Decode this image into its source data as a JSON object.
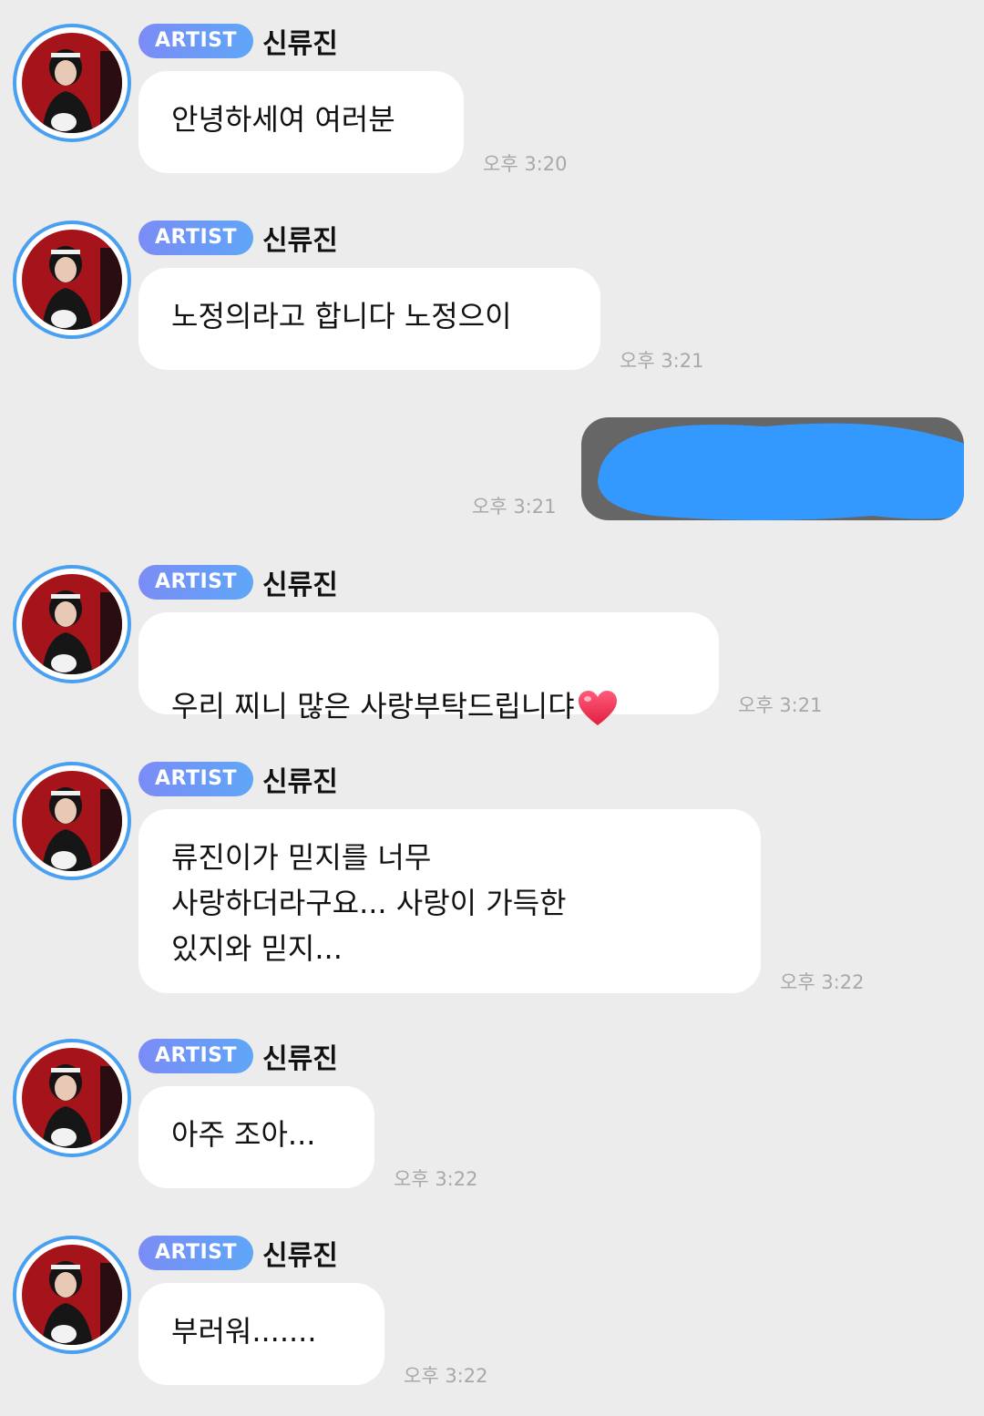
{
  "badge_label": "ARTIST",
  "sender_name": "신류진",
  "messages": [
    {
      "text": "안녕하세여 여러분",
      "time": "오후 3:20"
    },
    {
      "text": "노정의라고 합니다 노정으이",
      "time": "오후 3:21"
    },
    {
      "text": "우리 찌니 많은 사랑부탁드립니댜",
      "time": "오후 3:21"
    },
    {
      "text": "류진이가 믿지를 너무\n사랑하더라구요... 사랑이 가득한\n있지와 믿지...",
      "time": "오후 3:22"
    },
    {
      "text": "아주 조아...",
      "time": "오후 3:22"
    },
    {
      "text": "부러워.......",
      "time": "오후 3:22"
    }
  ],
  "my_message": {
    "time": "오후 3:21"
  },
  "colors": {
    "background": "#ececec",
    "bubble": "#ffffff",
    "badge_start": "#7b8cf6",
    "badge_end": "#5fa6f7",
    "avatar_ring": "#4aa0f0",
    "my_bubble": "#666666",
    "redaction": "#3399ff",
    "timestamp": "#a8a8a8"
  },
  "icons": {
    "heart": "red-heart-emoji"
  }
}
